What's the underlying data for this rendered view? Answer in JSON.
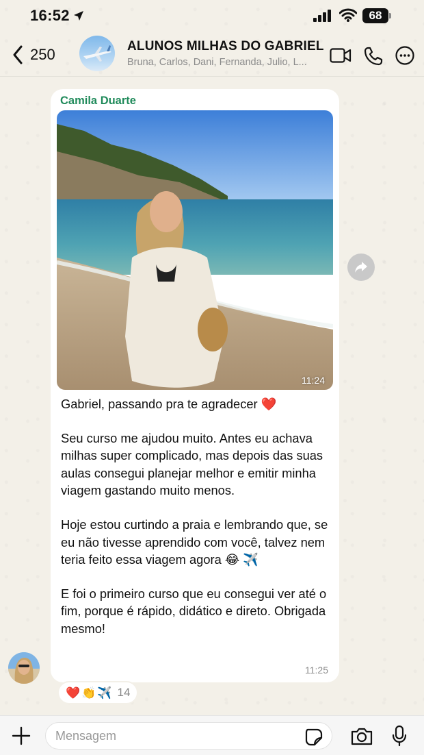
{
  "status_bar": {
    "time": "16:52",
    "battery": "68"
  },
  "header": {
    "back_count": "250",
    "title": "ALUNOS MILHAS DO GABRIEL",
    "members": "Bruna, Carlos, Dani, Fernanda, Julio, L..."
  },
  "message": {
    "sender": "Camila Duarte",
    "photo_time": "11:24",
    "paragraphs": [
      "Gabriel, passando pra te agradecer ❤️",
      "Seu curso me ajudou muito. Antes eu achava milhas super complicado, mas depois das suas aulas consegui planejar melhor e emitir minha viagem gastando muito menos.",
      "Hoje estou curtindo a praia e lembrando que, se eu não tivesse aprendido com você, talvez nem teria feito essa viagem agora 😂 ✈️",
      "E foi o primeiro curso que eu consegui ver até o fim, porque é rápido, didático e direto. Obrigada mesmo!"
    ],
    "time": "11:25",
    "reactions": {
      "emojis": [
        "❤️",
        "👏",
        "✈️"
      ],
      "count": "14"
    }
  },
  "input": {
    "placeholder": "Mensagem"
  },
  "colors": {
    "sender_name": "#1f8a5a",
    "bubble": "#ffffff",
    "wallpaper": "#f3f0e8"
  }
}
